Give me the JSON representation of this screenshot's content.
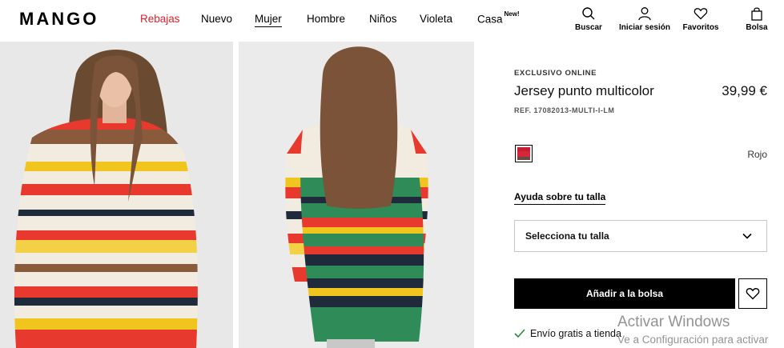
{
  "header": {
    "logo": "MANGO",
    "nav": [
      {
        "label": "Rebajas",
        "sale": true
      },
      {
        "label": "Nuevo"
      },
      {
        "label": "Mujer",
        "active": true
      },
      {
        "label": "Hombre"
      },
      {
        "label": "Niños"
      },
      {
        "label": "Violeta"
      },
      {
        "label": "Casa",
        "badge": "New!"
      }
    ],
    "actions": [
      {
        "label": "Buscar",
        "icon": "search-icon"
      },
      {
        "label": "Iniciar sesión",
        "icon": "user-icon"
      },
      {
        "label": "Favoritos",
        "icon": "heart-icon"
      },
      {
        "label": "Bolsa",
        "icon": "bag-icon"
      }
    ]
  },
  "product": {
    "eyebrow": "EXCLUSIVO ONLINE",
    "name": "Jersey punto multicolor",
    "price": "39,99 €",
    "ref": "REF. 17082013-MULTI-I-LM",
    "color_name": "Rojo",
    "size_help": "Ayuda sobre tu talla",
    "size_placeholder": "Selecciona tu talla",
    "add_to_bag": "Añadir a la bolsa",
    "shipping": "Envío gratis a tienda"
  },
  "colors": {
    "sale": "#e3202c",
    "primary_button": "#000000",
    "swatch": "#d7263b"
  },
  "watermark": {
    "line1": "Activar Windows",
    "line2": "Ve a Configuración para activar"
  }
}
